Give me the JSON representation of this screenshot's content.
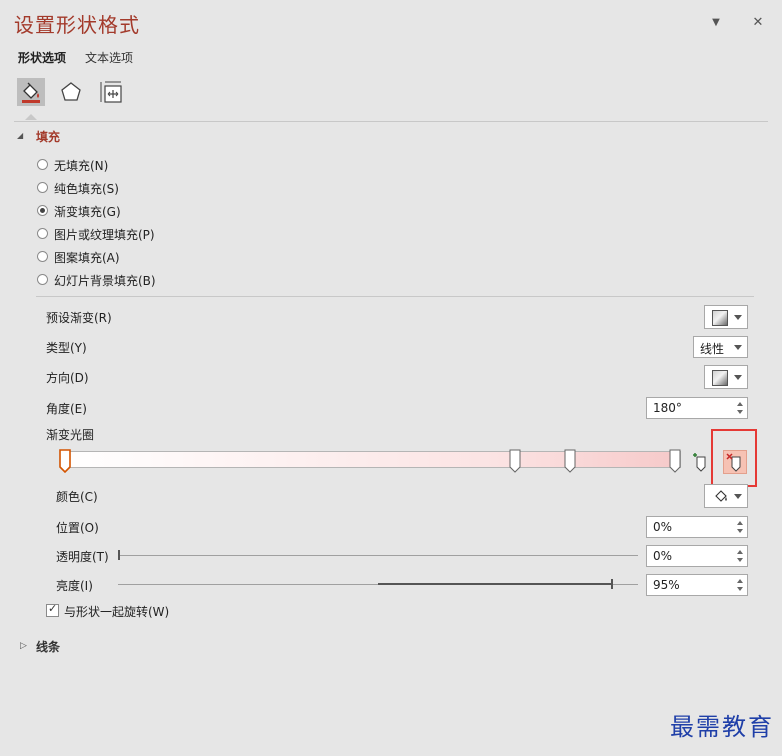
{
  "panel": {
    "title": "设置形状格式"
  },
  "header": {
    "collapse_icon": "▼",
    "close_icon": "✕"
  },
  "tabs": [
    {
      "label": "形状选项",
      "active": true
    },
    {
      "label": "文本选项",
      "active": false
    }
  ],
  "icon_tabs": [
    "fill-line-icon",
    "effects-pentagon-icon",
    "size-properties-icon"
  ],
  "fill": {
    "header": "填充",
    "options": [
      {
        "label": "无填充(N)",
        "selected": false
      },
      {
        "label": "纯色填充(S)",
        "selected": false
      },
      {
        "label": "渐变填充(G)",
        "selected": true
      },
      {
        "label": "图片或纹理填充(P)",
        "selected": false
      },
      {
        "label": "图案填充(A)",
        "selected": false
      },
      {
        "label": "幻灯片背景填充(B)",
        "selected": false
      }
    ],
    "preset_label": "预设渐变(R)",
    "type_label": "类型(Y)",
    "type_value": "线性",
    "direction_label": "方向(D)",
    "angle_label": "角度(E)",
    "angle_value": "180°",
    "gradient_stops_label": "渐变光圈",
    "gradient_stops": [
      0,
      73,
      82,
      99
    ],
    "color_label": "颜色(C)",
    "position_label": "位置(O)",
    "position_value": "0%",
    "transparency_label": "透明度(T)",
    "transparency_value": "0%",
    "transparency_level": 0,
    "brightness_label": "亮度(I)",
    "brightness_value": "95%",
    "brightness_level": 95,
    "rotate_label": "与形状一起旋转(W)",
    "rotate_checked": true
  },
  "line": {
    "header": "线条"
  },
  "watermark": "最需教育",
  "colors": {
    "accent": "#a33a2b",
    "highlight": "#e53935",
    "watermark": "#1f3fa8"
  }
}
